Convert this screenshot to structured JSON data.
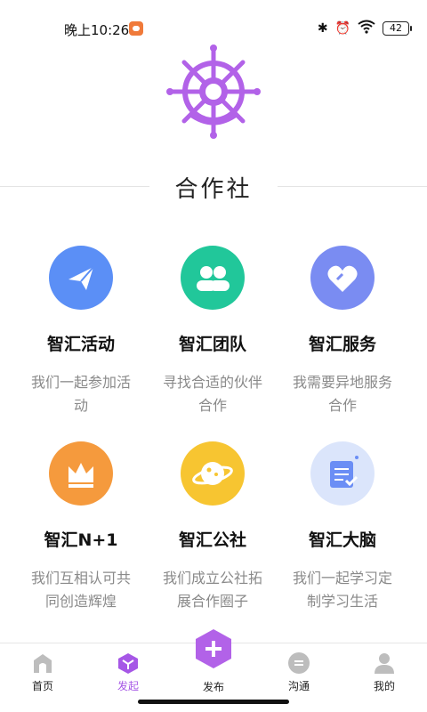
{
  "status_bar": {
    "time": "晚上10:26",
    "battery": "42",
    "icons": [
      "bluetooth-icon",
      "alarm-icon",
      "wifi-icon",
      "battery-icon"
    ]
  },
  "header": {
    "logo": "ship-wheel-logo",
    "title": "合作社"
  },
  "cards": [
    {
      "title": "智汇活动",
      "desc": "我们一起参加活动",
      "icon": "paper-plane-icon",
      "color": "#5b8ff6"
    },
    {
      "title": "智汇团队",
      "desc": "寻找合适的伙伴合作",
      "icon": "people-icon",
      "color": "#21c79a"
    },
    {
      "title": "智汇服务",
      "desc": "我需要异地服务合作",
      "icon": "heart-icon",
      "color": "#7a8cf2"
    },
    {
      "title": "智汇N+1",
      "desc": "我们互相认可共同创造辉煌",
      "icon": "crown-icon",
      "color": "#f59a3d"
    },
    {
      "title": "智汇公社",
      "desc": "我们成立公社拓展合作圈子",
      "icon": "planet-icon",
      "color": "#f7c531"
    },
    {
      "title": "智汇大脑",
      "desc": "我们一起学习定制学习生活",
      "icon": "study-note-icon",
      "color": "#dbe5fb"
    }
  ],
  "tabbar": {
    "items": [
      {
        "label": "首页",
        "icon": "home-icon",
        "active": false
      },
      {
        "label": "发起",
        "icon": "cube-icon",
        "active": true
      },
      {
        "label": "沟通",
        "icon": "chat-icon",
        "active": false
      },
      {
        "label": "我的",
        "icon": "user-icon",
        "active": false
      }
    ],
    "publish_label": "发布"
  },
  "colors": {
    "accent": "#a657e6",
    "logo": "#b262e8",
    "inactive_icon": "#bdbdbd"
  }
}
